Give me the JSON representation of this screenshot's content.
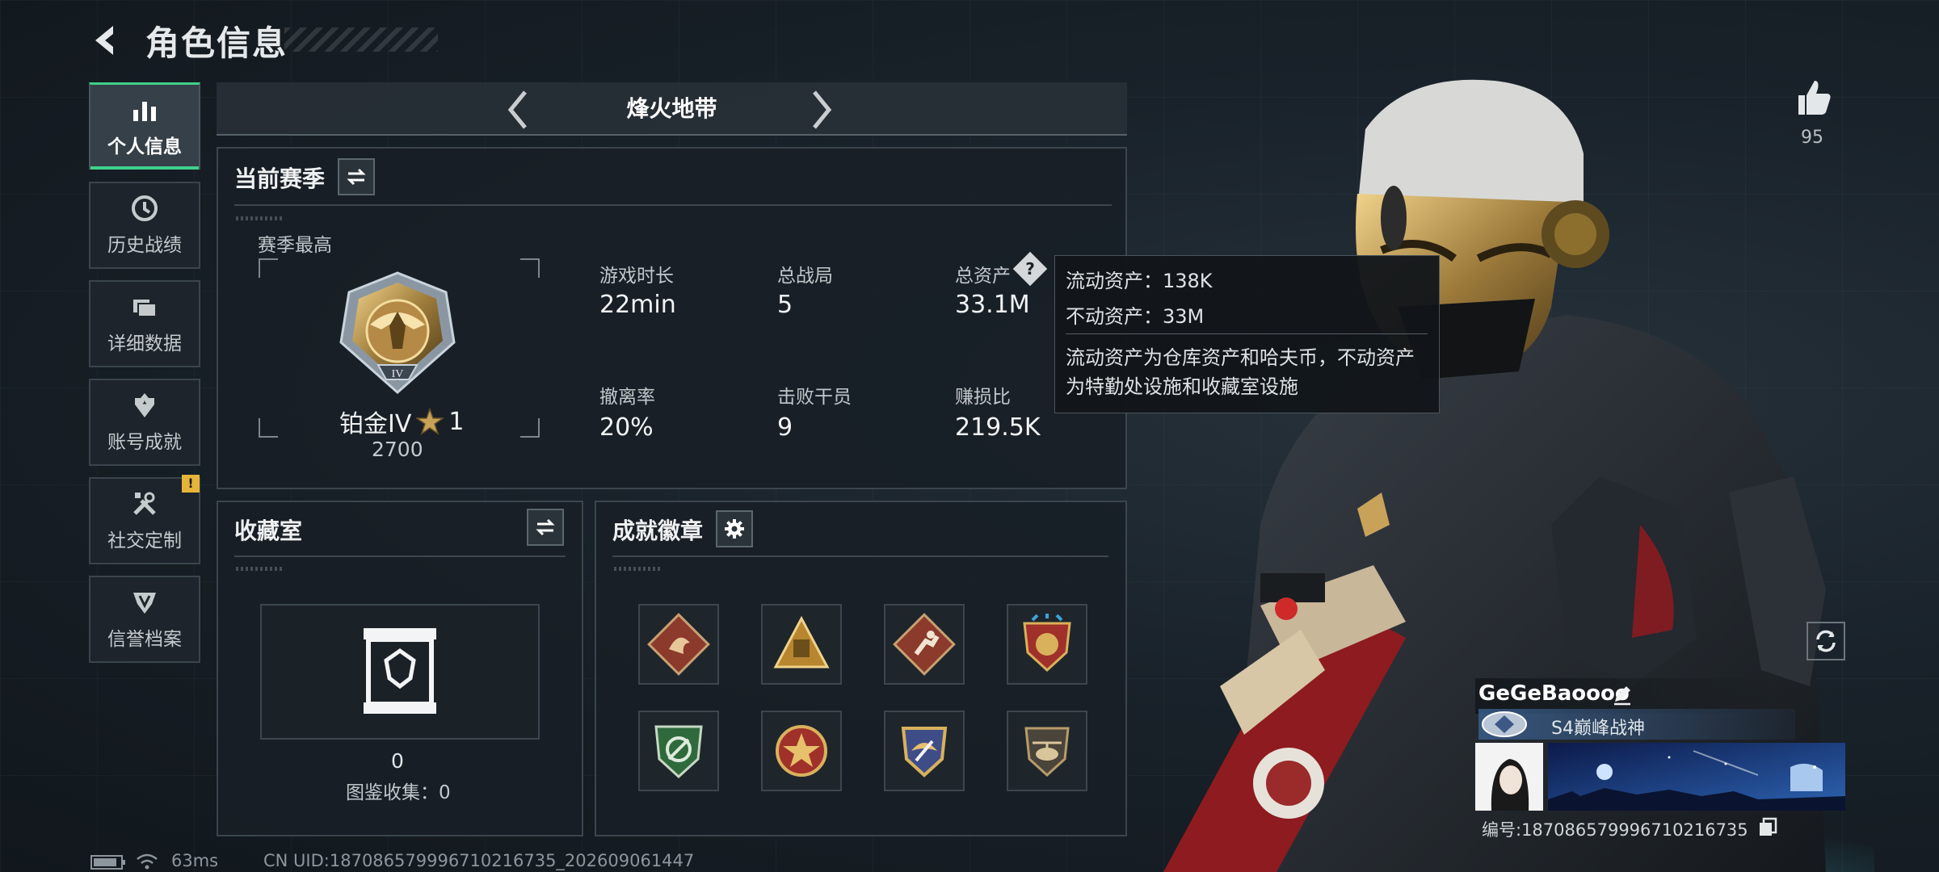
{
  "header": {
    "title": "角色信息"
  },
  "sidebar": {
    "items": [
      {
        "label": "个人信息"
      },
      {
        "label": "历史战绩"
      },
      {
        "label": "详细数据"
      },
      {
        "label": "账号成就"
      },
      {
        "label": "社交定制"
      },
      {
        "label": "信誉档案"
      }
    ],
    "warning_badge": "!"
  },
  "mode": {
    "title": "烽火地带"
  },
  "season": {
    "title": "当前赛季",
    "best_label": "赛季最高",
    "rank_name": "铂金IV",
    "rank_stars": "1",
    "rank_score": "2700",
    "rank_numeral": "IV",
    "stats": [
      {
        "label": "游戏时长",
        "value": "22min"
      },
      {
        "label": "总战局",
        "value": "5"
      },
      {
        "label": "总资产",
        "value": "33.1M"
      },
      {
        "label": "撤离率",
        "value": "20%"
      },
      {
        "label": "击败干员",
        "value": "9"
      },
      {
        "label": "赚损比",
        "value": "219.5K"
      }
    ],
    "help_glyph": "?"
  },
  "tooltip": {
    "line1": "流动资产：138K",
    "line2": "不动资产：33M",
    "desc_1": "流动资产为仓库资产和哈夫币，不动资产",
    "desc_2": "为特勤处设施和收藏室设施"
  },
  "collection": {
    "title": "收藏室",
    "count": "0",
    "codex": "图鉴收集：0"
  },
  "achievements": {
    "title": "成就徽章",
    "badges": [
      "dragon-badge",
      "pyramid-badge",
      "runner-badge",
      "shield-star-badge",
      "green-crest-badge",
      "star-medal-badge",
      "wing-crest-badge",
      "helicopter-badge"
    ]
  },
  "profile": {
    "likes": "95",
    "username": "GeGeBaoooo",
    "title": "S4巅峰战神",
    "id_line": "编号:18708657999671021673​5"
  },
  "status": {
    "ping": "63ms",
    "cn_uid": "CN UID:18708657999671021673​5_202609061447"
  },
  "colors": {
    "accent": "#3fd08a",
    "gold": "#c9a25a",
    "warning": "#e7b43a"
  }
}
